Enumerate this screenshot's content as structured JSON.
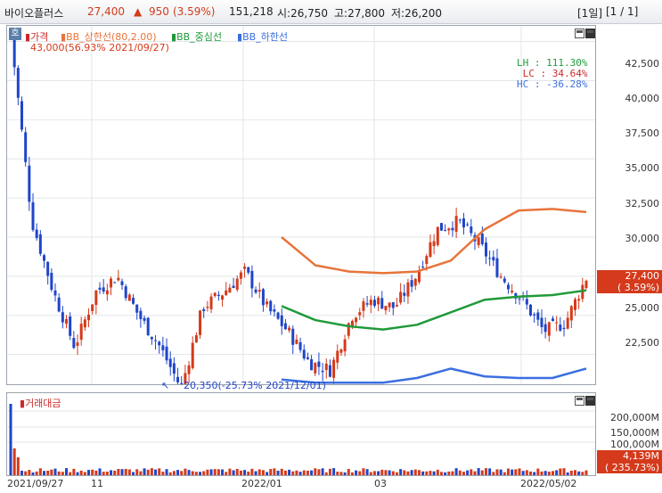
{
  "header": {
    "name": "바이오플러스",
    "price": "27,400",
    "change_arrow": "▲",
    "change": "950",
    "change_pct": "(3.59%)",
    "volume": "151,218",
    "open": "시:26,750",
    "high": "고:27,800",
    "low": "저:26,200",
    "period": "[1일]",
    "page": "[1 / 1]"
  },
  "price_panel": {
    "badge": "호",
    "legend": [
      {
        "label": "가격",
        "color": "#cc2a2a"
      },
      {
        "label": "BB_상한선(80,2.00)",
        "color": "#e8743b"
      },
      {
        "label": "BB_중심선",
        "color": "#1f9a3a"
      },
      {
        "label": "BB_하한선",
        "color": "#3b6fe0"
      }
    ],
    "high_note": "43,000(56.93% 2021/09/27)",
    "low_note": "20,350(-25.73% 2021/12/01)",
    "stats": [
      {
        "label": "LH : ",
        "value": "111.30%",
        "color": "#1f9a3a"
      },
      {
        "label": "LC : ",
        "value": "34.64%",
        "color": "#cc2a2a"
      },
      {
        "label": "HC : ",
        "value": "-36.28%",
        "color": "#3b6fe0"
      }
    ],
    "yticks": [
      "42,500",
      "40,000",
      "37,500",
      "35,000",
      "32,500",
      "30,000",
      "27,500",
      "25,000",
      "22,500"
    ],
    "last_price_tag": "27,400",
    "last_pct_tag": "( 3.59%)"
  },
  "volume_panel": {
    "legend": "거래대금",
    "yticks": [
      "200,000M",
      "150,000M",
      "100,000M"
    ],
    "last_value_tag": "4,139M",
    "last_pct_tag": "( 235.73%)"
  },
  "xaxis": [
    "2021/09/27",
    "11",
    "2022/01",
    "03",
    "2022/05/02"
  ],
  "colors": {
    "up": "#d43a1b",
    "down": "#1f45c8",
    "upper": "#e8743b",
    "mid": "#1f9a3a",
    "lower": "#3b6fe0"
  },
  "chart_data": {
    "type": "candlestick",
    "x_range": [
      "2021/09/27",
      "2022/05/02"
    ],
    "ylim": [
      21000,
      43500
    ],
    "close_trend": [
      {
        "date": "2021/09/27",
        "value": 43000
      },
      {
        "date": "2021/10",
        "value": 31000
      },
      {
        "date": "2021/10",
        "value": 26500
      },
      {
        "date": "2021/10",
        "value": 23000
      },
      {
        "date": "2021/10",
        "value": 26500
      },
      {
        "date": "2021/11",
        "value": 27500
      },
      {
        "date": "2021/11",
        "value": 25000
      },
      {
        "date": "2021/11",
        "value": 23000
      },
      {
        "date": "2021/12/01",
        "value": 20350
      },
      {
        "date": "2021/12",
        "value": 25500
      },
      {
        "date": "2021/12",
        "value": 26500
      },
      {
        "date": "2022/01",
        "value": 27800
      },
      {
        "date": "2022/01",
        "value": 25500
      },
      {
        "date": "2022/01",
        "value": 24000
      },
      {
        "date": "2022/02",
        "value": 22000
      },
      {
        "date": "2022/02",
        "value": 21500
      },
      {
        "date": "2022/03",
        "value": 25000
      },
      {
        "date": "2022/03",
        "value": 26000
      },
      {
        "date": "2022/03",
        "value": 25500
      },
      {
        "date": "2022/04",
        "value": 27500
      },
      {
        "date": "2022/04",
        "value": 30500
      },
      {
        "date": "2022/04",
        "value": 31000
      },
      {
        "date": "2022/04",
        "value": 29500
      },
      {
        "date": "2022/04",
        "value": 27500
      },
      {
        "date": "2022/05",
        "value": 26000
      },
      {
        "date": "2022/05",
        "value": 24000
      },
      {
        "date": "2022/05",
        "value": 24500
      },
      {
        "date": "2022/05",
        "value": 27400
      }
    ],
    "bb_upper": [
      30000,
      28200,
      27800,
      27700,
      27800,
      28500,
      30500,
      31700,
      31800,
      31600
    ],
    "bb_mid": [
      25600,
      24700,
      24300,
      24100,
      24400,
      25200,
      26000,
      26200,
      26300,
      26600
    ],
    "bb_lower": [
      20900,
      20700,
      20700,
      20700,
      21000,
      21600,
      21100,
      21000,
      21000,
      21600
    ]
  }
}
